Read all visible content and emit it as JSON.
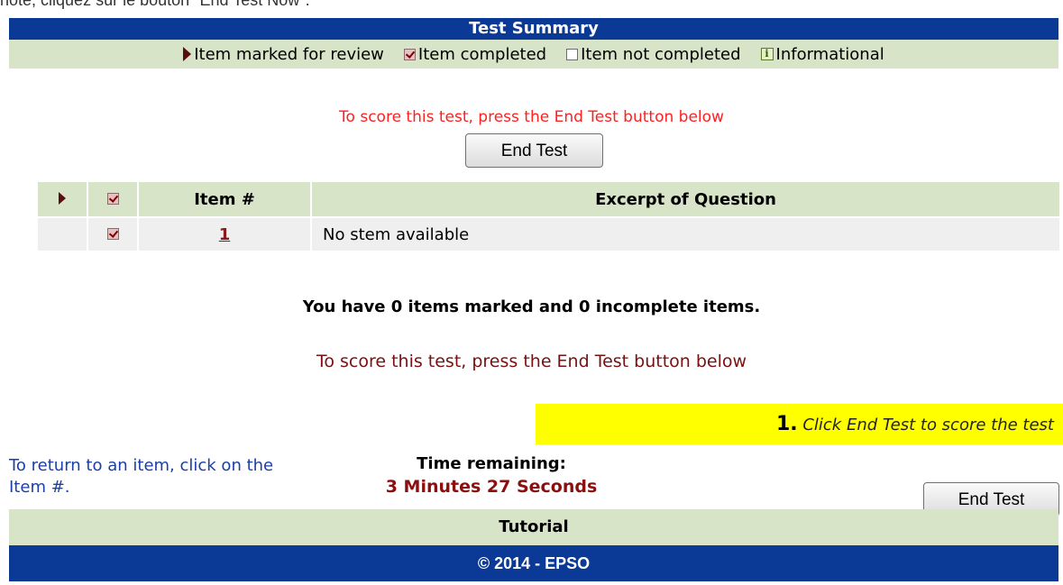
{
  "top_note": "note, cliquez sur le bouton \"End Test Now\".",
  "title": "Test Summary",
  "legend": {
    "marked": "Item marked for review",
    "completed": "Item completed",
    "not_completed": "Item not completed",
    "informational": "Informational",
    "info_glyph": "i"
  },
  "notice_top": "To score this test, press the End Test button below",
  "end_test_label": "End Test",
  "table": {
    "headers": {
      "item": "Item #",
      "excerpt": "Excerpt of Question"
    },
    "rows": [
      {
        "item": "1",
        "excerpt": "No stem available",
        "completed": true,
        "marked": false
      }
    ]
  },
  "summary_count": "You have 0 items marked and 0 incomplete items.",
  "notice_bottom": "To score this test, press the End Test button below",
  "tooltip": {
    "step": "1.",
    "text": "Click End Test to score the test"
  },
  "return_hint": "To return to an item, click on the Item #.",
  "time": {
    "label": "Time remaining:",
    "value": "3 Minutes 27 Seconds"
  },
  "tutorial": "Tutorial",
  "footer": "© 2014 - EPSO",
  "colors": {
    "header_blue": "#0b3a96",
    "light_green": "#d8e4c8",
    "notice_red": "#ff2020",
    "dark_red": "#8b0f0f",
    "link_blue": "#1a3fa8",
    "tooltip_yellow": "#ffff00"
  }
}
